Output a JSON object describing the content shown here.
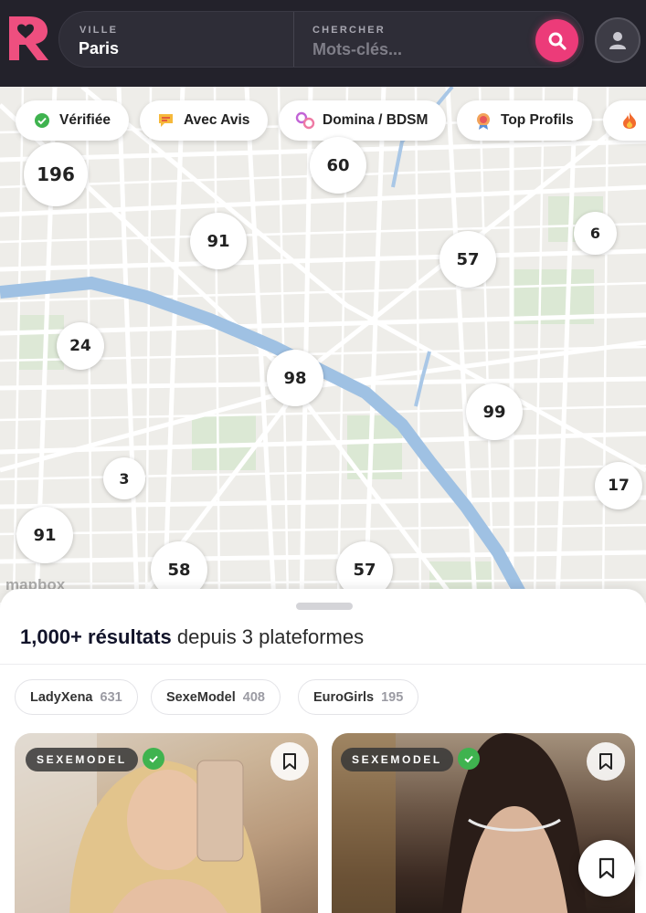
{
  "header": {
    "city_label": "VILLE",
    "city_value": "Paris",
    "search_label": "CHERCHER",
    "search_placeholder": "Mots-clés...",
    "logo_letter": "R",
    "accent_color": "#ec3b79"
  },
  "filters": [
    {
      "label": "Vérifiée",
      "icon": "verified-check-icon"
    },
    {
      "label": "Avec Avis",
      "icon": "review-icon"
    },
    {
      "label": "Domina / BDSM",
      "icon": "handcuffs-icon"
    },
    {
      "label": "Top Profils",
      "icon": "medal-icon"
    },
    {
      "label": "",
      "icon": "fire-icon"
    }
  ],
  "map": {
    "clusters": [
      "196",
      "60",
      "91",
      "57",
      "6",
      "24",
      "98",
      "99",
      "3",
      "17",
      "91",
      "58",
      "57"
    ],
    "attribution": "mapbox"
  },
  "results": {
    "count": "1,000+ résultats",
    "suffix": "depuis 3 plateformes"
  },
  "platforms": [
    {
      "name": "LadyXena",
      "count": "631"
    },
    {
      "name": "SexeModel",
      "count": "408"
    },
    {
      "name": "EuroGirls",
      "count": "195"
    }
  ],
  "cards": [
    {
      "platform": "SEXEMODEL",
      "verified": true
    },
    {
      "platform": "SEXEMODEL",
      "verified": true
    }
  ]
}
